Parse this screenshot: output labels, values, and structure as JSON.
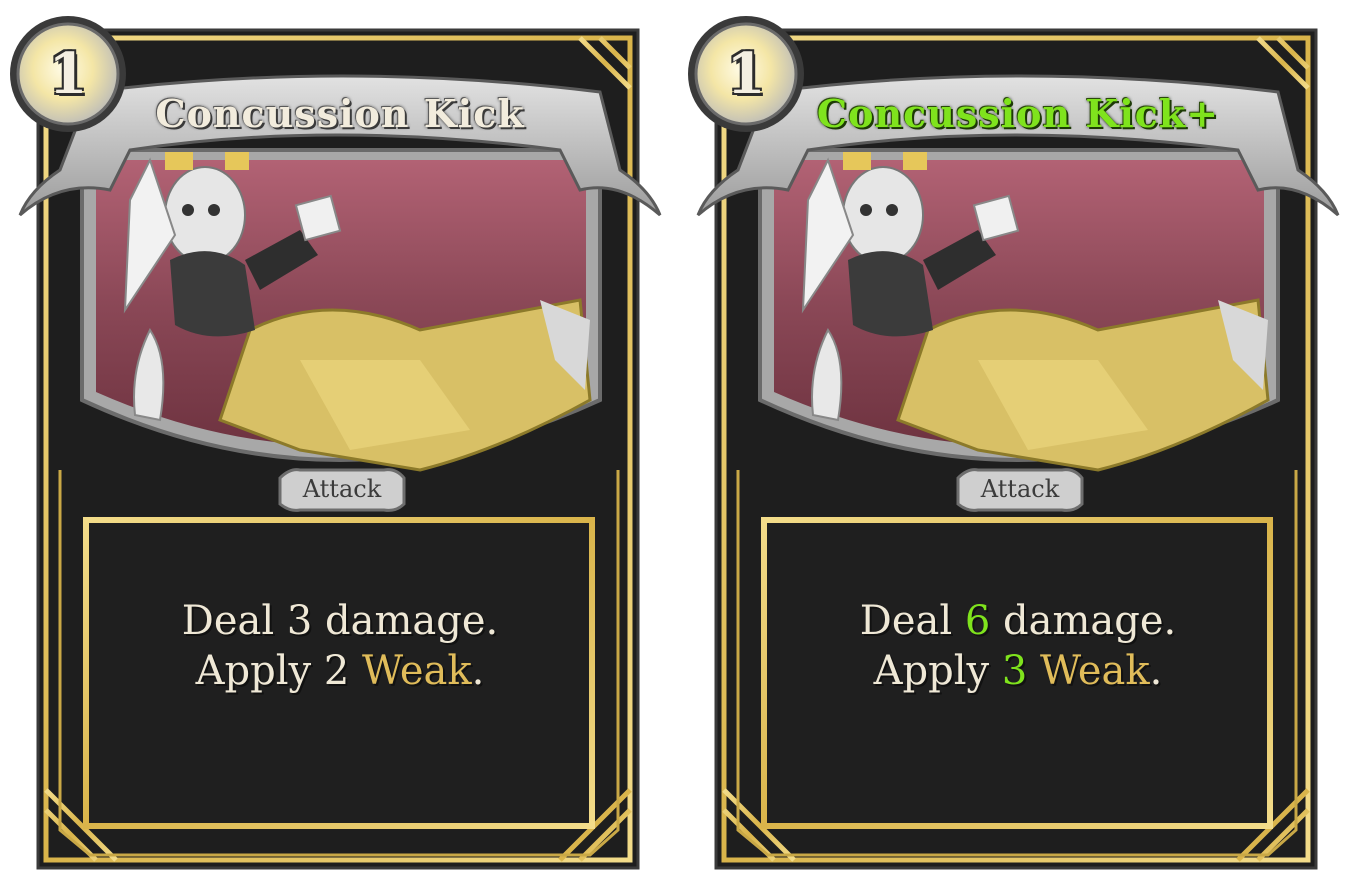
{
  "cards": [
    {
      "cost": "1",
      "title": "Concussion Kick",
      "type": "Attack",
      "desc": {
        "line1_pre": "Deal ",
        "damage": "3",
        "line1_post": " damage.",
        "line2_pre": "Apply ",
        "weak_amount": "2",
        "keyword": "Weak",
        "line2_post": "."
      }
    },
    {
      "cost": "1",
      "title": "Concussion Kick+",
      "type": "Attack",
      "desc": {
        "line1_pre": "Deal ",
        "damage": "6",
        "line1_post": " damage.",
        "line2_pre": "Apply ",
        "weak_amount": "3",
        "keyword": "Weak",
        "line2_post": "."
      }
    }
  ],
  "colors": {
    "frame_black": "#1e1e1e",
    "frame_gold": "#e6c75a",
    "art_background": "#8a4a58",
    "banner_gray": "#c8c8c8",
    "keyword_gold": "#e0bc5a",
    "upgrade_green": "#7fe31d"
  }
}
